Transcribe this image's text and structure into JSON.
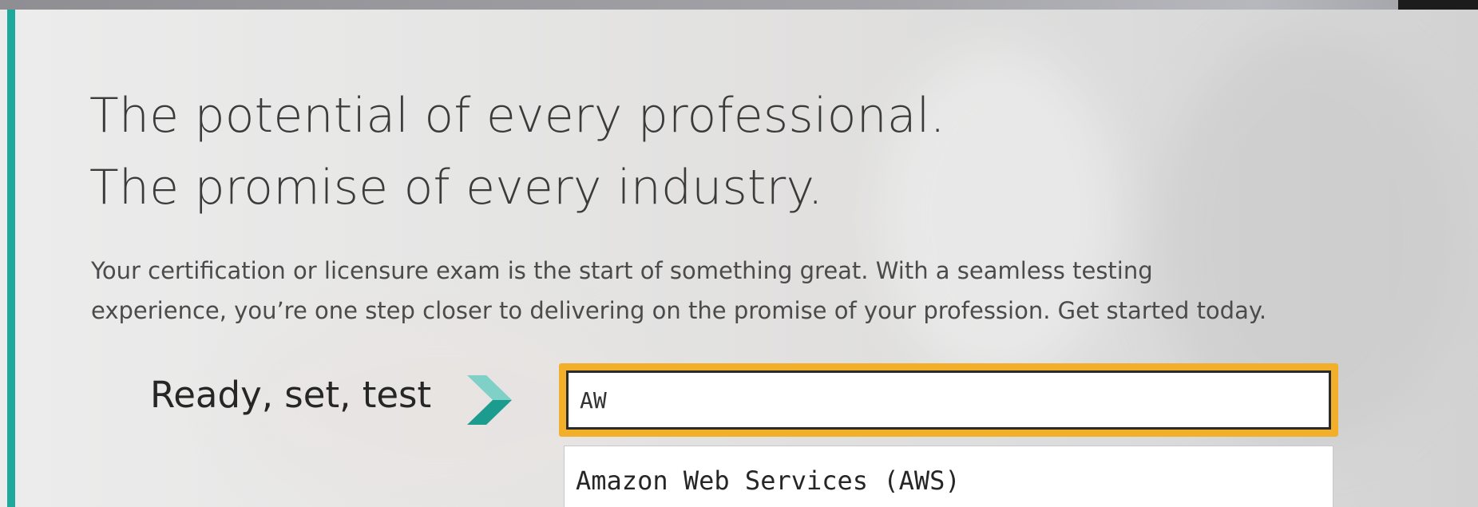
{
  "hero": {
    "headline_line1": "The potential of every professional.",
    "headline_line2": "The promise of every industry.",
    "subtext_line1": "Your certification or licensure exam is the start of something great. With a seamless testing",
    "subtext_line2": "experience, you’re one step closer to delivering on the promise of your profession. Get started today."
  },
  "search": {
    "label": "Ready, set, test",
    "icon": "chevron-right-icon",
    "value": "AW",
    "suggestions": [
      "Amazon Web Services (AWS)"
    ]
  },
  "colors": {
    "accent": "#1fa99c",
    "focus": "#f2b02a",
    "chevron_light": "#7fd0c6",
    "chevron_dark": "#1c9b8f"
  }
}
